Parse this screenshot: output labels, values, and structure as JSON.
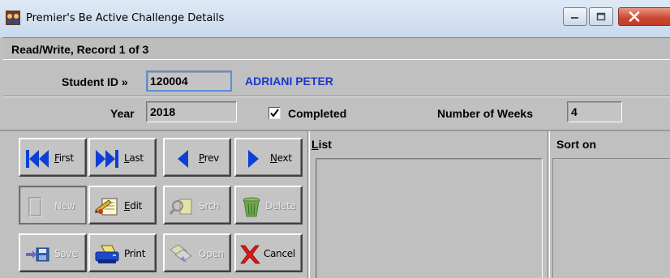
{
  "window": {
    "title": "Premier's Be Active Challenge Details"
  },
  "status": {
    "text": "Read/Write, Record 1 of 3"
  },
  "record": {
    "student_id_label": "Student ID »",
    "student_id_value": "120004",
    "student_name": "ADRIANI PETER",
    "year_label": "Year",
    "year_value": "2018",
    "completed_label": "Completed",
    "completed_checked": true,
    "completed_mark": "✔",
    "weeks_label": "Number of Weeks",
    "weeks_value": "4"
  },
  "toolbar": {
    "buttons": [
      {
        "label": "First",
        "mnemonic": "F",
        "rest": "irst",
        "icon": "first-record-icon",
        "enabled": true
      },
      {
        "label": "Last",
        "mnemonic": "L",
        "rest": "ast",
        "icon": "last-record-icon",
        "enabled": true
      },
      {
        "label": "Prev",
        "mnemonic": "P",
        "rest": "rev",
        "icon": "prev-record-icon",
        "enabled": true
      },
      {
        "label": "Next",
        "mnemonic": "N",
        "rest": "ext",
        "icon": "next-record-icon",
        "enabled": true
      },
      {
        "label": "New",
        "mnemonic": "",
        "rest": "New",
        "icon": "new-record-icon",
        "enabled": false
      },
      {
        "label": "Edit",
        "mnemonic": "E",
        "rest": "dit",
        "icon": "edit-icon",
        "enabled": true
      },
      {
        "label": "Srch",
        "mnemonic": "",
        "rest": "Srch",
        "icon": "search-icon",
        "enabled": false
      },
      {
        "label": "Delete",
        "mnemonic": "",
        "rest": "Delete",
        "icon": "delete-icon",
        "enabled": false
      },
      {
        "label": "Save",
        "mnemonic": "",
        "rest": "Save",
        "icon": "save-icon",
        "enabled": false
      },
      {
        "label": "Print",
        "mnemonic": "",
        "rest": "Print",
        "icon": "print-icon",
        "enabled": true
      },
      {
        "label": "Open",
        "mnemonic": "",
        "rest": "Open",
        "icon": "open-icon",
        "enabled": false
      },
      {
        "label": "Cancel",
        "mnemonic": "",
        "rest": "Cancel",
        "icon": "cancel-icon",
        "enabled": true
      }
    ]
  },
  "list": {
    "label_mnemonic": "L",
    "label_rest": "ist"
  },
  "sort": {
    "label": "Sort on"
  },
  "colors": {
    "window_bg": "#c0c0c0",
    "student_name": "#1c37c9",
    "focus_border": "#5b8fd6",
    "close_button": "#c94631"
  }
}
